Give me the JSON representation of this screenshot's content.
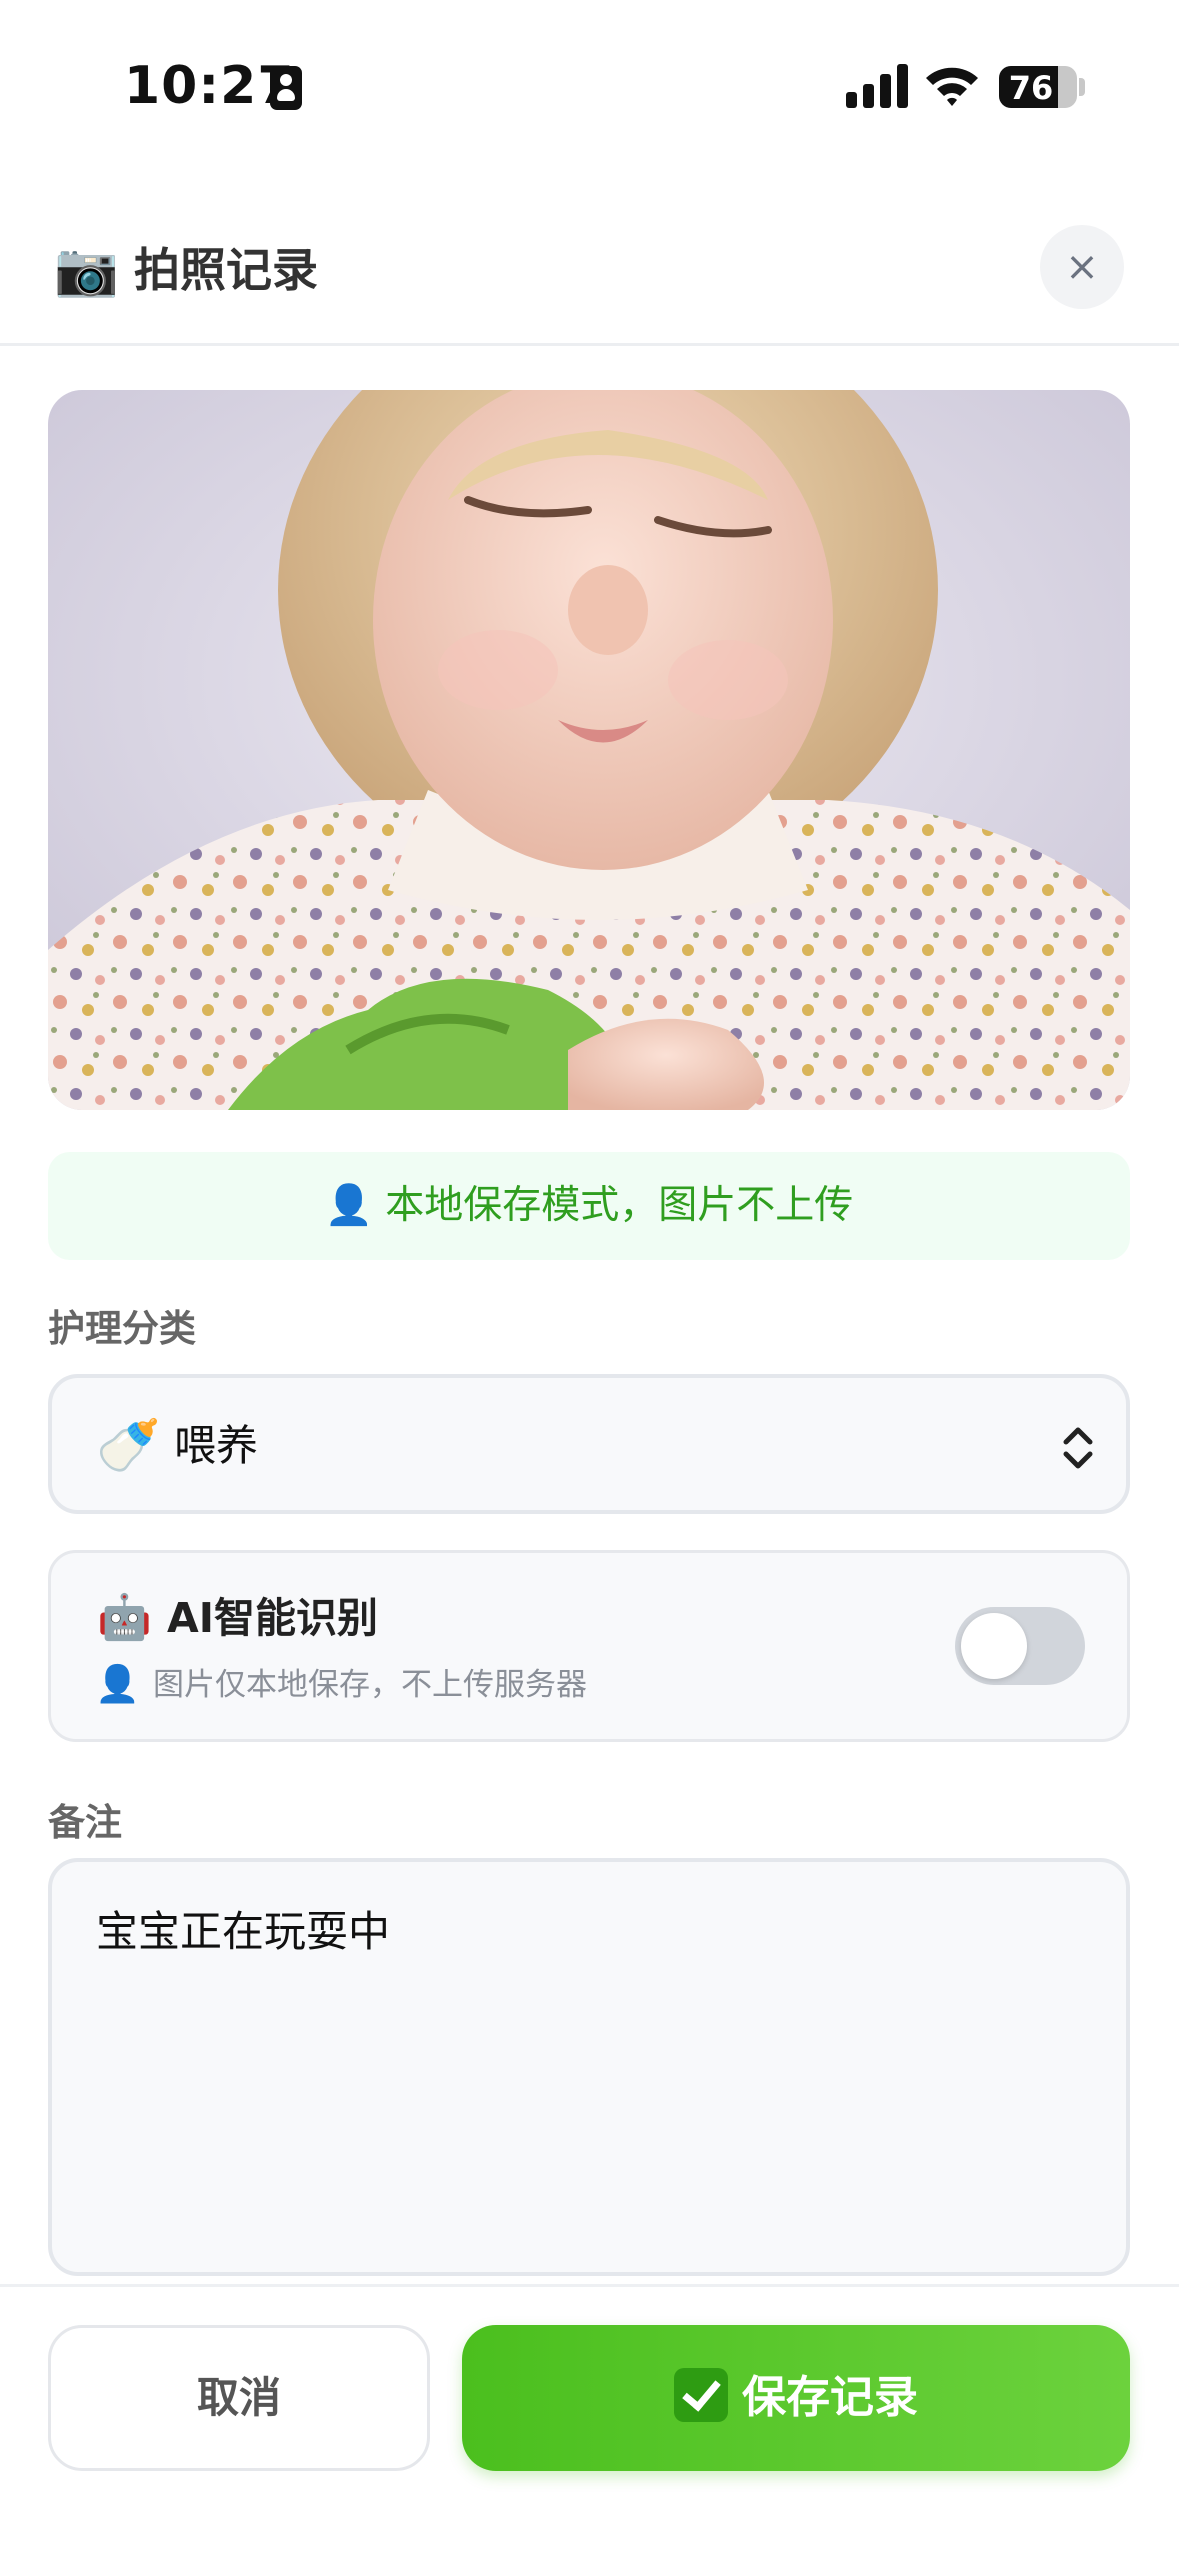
{
  "status_bar": {
    "time": "10:27",
    "battery_level": "76",
    "battery_fraction": 0.76
  },
  "header": {
    "icon": "📷",
    "title": "拍照记录",
    "close_label": "×"
  },
  "photo": {
    "icon_name": "baby-photo"
  },
  "local_banner": {
    "icon": "👤",
    "text": "本地保存模式，图片不上传"
  },
  "category": {
    "label": "护理分类",
    "selected_icon": "🍼",
    "selected_value": "喂养"
  },
  "ai_recognition": {
    "icon": "🤖",
    "title": "AI智能识别",
    "sub_icon": "👤",
    "subtitle": "图片仅本地保存，不上传服务器",
    "enabled": false
  },
  "notes": {
    "label": "备注",
    "value": "宝宝正在玩耍中"
  },
  "actions": {
    "cancel_label": "取消",
    "save_label": "保存记录"
  },
  "colors": {
    "accent_green": "#52c41a",
    "banner_bg": "#f0fdf4",
    "banner_text": "#2f9e1f"
  }
}
